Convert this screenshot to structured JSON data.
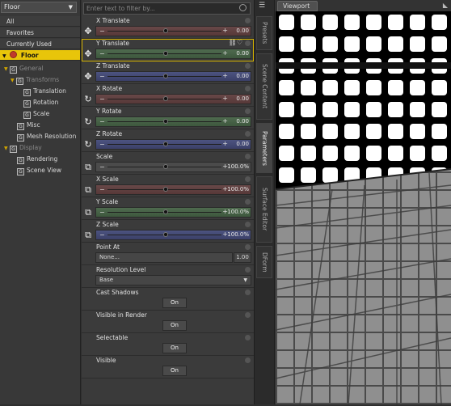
{
  "scene_selector": {
    "value": "Floor"
  },
  "left_list": [
    "All",
    "Favorites",
    "Currently Used"
  ],
  "tree": {
    "root": "Floor",
    "general": "General",
    "transforms": "Transforms",
    "translation": "Translation",
    "rotation": "Rotation",
    "scale": "Scale",
    "misc": "Misc",
    "mesh_resolution": "Mesh Resolution",
    "display": "Display",
    "rendering": "Rendering",
    "scene_view": "Scene View"
  },
  "search": {
    "placeholder": "Enter text to filter by..."
  },
  "properties": [
    {
      "label": "X Translate",
      "value": "0.00",
      "fraction": 0.5,
      "tint": "x",
      "icon": "move-icon"
    },
    {
      "label": "Y Translate",
      "value": "0.00",
      "fraction": 0.5,
      "tint": "y",
      "icon": "move-icon"
    },
    {
      "label": "Z Translate",
      "value": "0.00",
      "fraction": 0.5,
      "tint": "z",
      "icon": "move-icon"
    },
    {
      "label": "X Rotate",
      "value": "0.00",
      "fraction": 0.5,
      "tint": "x",
      "icon": "rotate-icon"
    },
    {
      "label": "Y Rotate",
      "value": "0.00",
      "fraction": 0.5,
      "tint": "y",
      "icon": "rotate-icon"
    },
    {
      "label": "Z Rotate",
      "value": "0.00",
      "fraction": 0.5,
      "tint": "z",
      "icon": "rotate-icon"
    },
    {
      "label": "Scale",
      "value": "100.0%",
      "fraction": 0.5,
      "tint": "n",
      "icon": "scale-icon"
    },
    {
      "label": "X Scale",
      "value": "100.0%",
      "fraction": 0.5,
      "tint": "x",
      "icon": "scale-icon"
    },
    {
      "label": "Y Scale",
      "value": "100.0%",
      "fraction": 0.5,
      "tint": "y",
      "icon": "scale-icon"
    },
    {
      "label": "Z Scale",
      "value": "100.0%",
      "fraction": 0.5,
      "tint": "z",
      "icon": "scale-icon"
    }
  ],
  "point_at": {
    "label": "Point At",
    "value": "None...",
    "number": "1.00"
  },
  "resolution": {
    "label": "Resolution Level",
    "value": "Base"
  },
  "toggles": [
    {
      "label": "Cast Shadows",
      "value": "On"
    },
    {
      "label": "Visible in Render",
      "value": "On"
    },
    {
      "label": "Selectable",
      "value": "On"
    },
    {
      "label": "Visible",
      "value": "On"
    }
  ],
  "side_tabs": [
    "Presets",
    "Scene Content",
    "Parameters",
    "Surface Editor",
    "DForm"
  ],
  "viewport": {
    "tab": "Viewport"
  }
}
